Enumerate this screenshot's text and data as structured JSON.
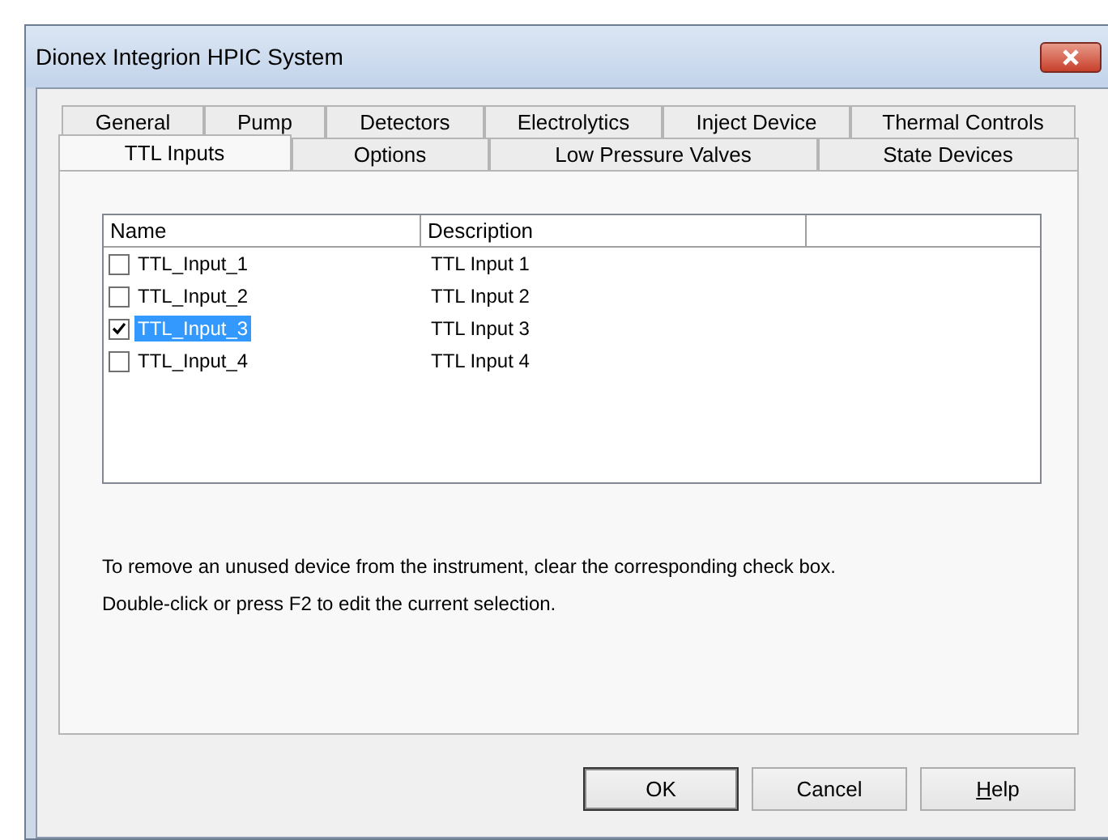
{
  "window": {
    "title": "Dionex Integrion HPIC System"
  },
  "tab_rows": [
    {
      "tabs": [
        {
          "label": "General",
          "selected": false
        },
        {
          "label": "Pump",
          "selected": false
        },
        {
          "label": "Detectors",
          "selected": false
        },
        {
          "label": "Electrolytics",
          "selected": false
        },
        {
          "label": "Inject Device",
          "selected": false
        },
        {
          "label": "Thermal Controls",
          "selected": false
        }
      ]
    },
    {
      "tabs": [
        {
          "label": "TTL Inputs",
          "selected": true
        },
        {
          "label": "Options",
          "selected": false
        },
        {
          "label": "Low Pressure Valves",
          "selected": false
        },
        {
          "label": "State Devices",
          "selected": false
        }
      ]
    }
  ],
  "table": {
    "columns": [
      "Name",
      "Description"
    ],
    "rows": [
      {
        "name": "TTL_Input_1",
        "description": "TTL Input 1",
        "checked": false,
        "selected": false
      },
      {
        "name": "TTL_Input_2",
        "description": "TTL Input 2",
        "checked": false,
        "selected": false
      },
      {
        "name": "TTL_Input_3",
        "description": "TTL Input 3",
        "checked": true,
        "selected": true
      },
      {
        "name": "TTL_Input_4",
        "description": "TTL Input 4",
        "checked": false,
        "selected": false
      }
    ]
  },
  "notes": [
    "To remove an unused device from the instrument, clear the corresponding check box.",
    "Double-click or press F2 to edit the current selection."
  ],
  "buttons": [
    {
      "label": "OK",
      "default": true,
      "mnemonic": false
    },
    {
      "label": "Cancel",
      "default": false,
      "mnemonic": false
    },
    {
      "label": "Help",
      "default": false,
      "mnemonic": true
    }
  ]
}
